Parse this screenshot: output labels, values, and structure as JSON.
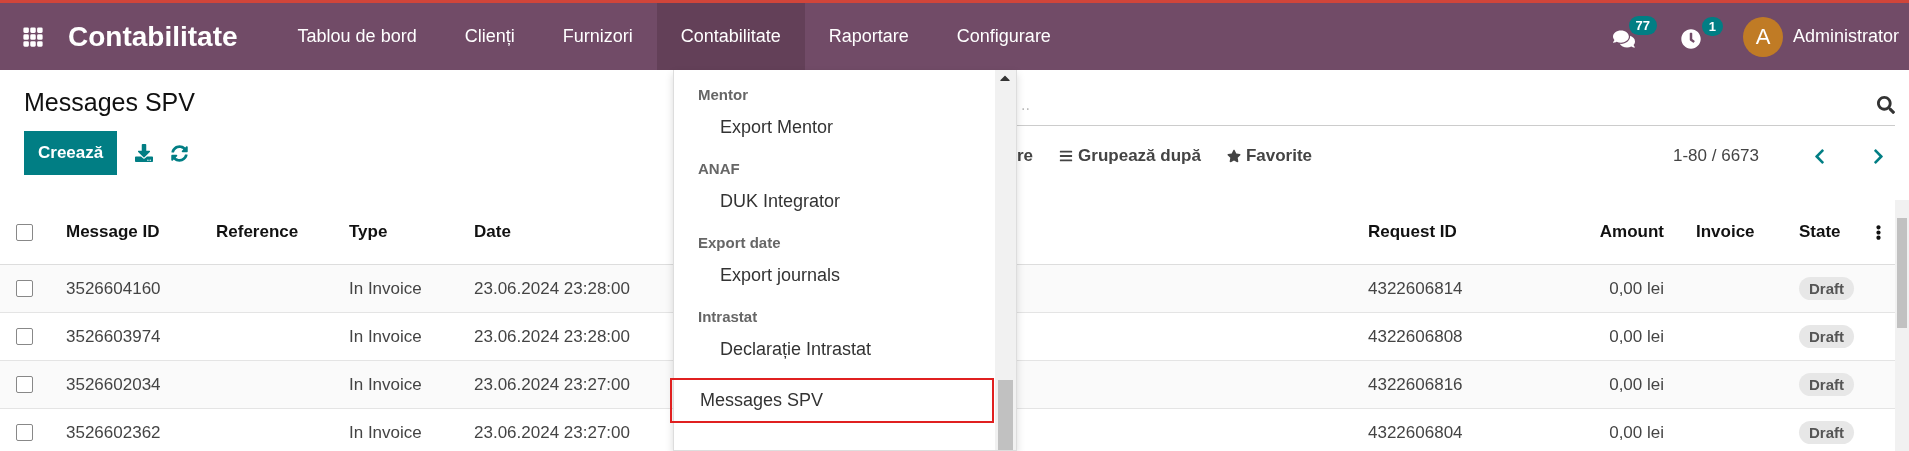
{
  "navbar": {
    "app_name": "Contabilitate",
    "menu": [
      {
        "label": "Tablou de bord",
        "selected": false
      },
      {
        "label": "Clienți",
        "selected": false
      },
      {
        "label": "Furnizori",
        "selected": false
      },
      {
        "label": "Contabilitate",
        "selected": true
      },
      {
        "label": "Raportare",
        "selected": false
      },
      {
        "label": "Configurare",
        "selected": false
      }
    ],
    "messages_badge": "77",
    "activities_badge": "1",
    "user": {
      "initial": "A",
      "name": "Administrator"
    }
  },
  "page": {
    "title": "Messages SPV",
    "create_button": "Creează"
  },
  "search": {
    "placeholder": ".."
  },
  "filters": [
    {
      "kind": "partial",
      "label": "re"
    },
    {
      "kind": "group",
      "label": "Grupează după"
    },
    {
      "kind": "favorite",
      "label": "Favorite"
    }
  ],
  "pager": "1-80 / 6673",
  "table": {
    "select_all_checked": false,
    "columns": [
      "Message ID",
      "Reference",
      "Type",
      "Date",
      "Request ID",
      "Amount",
      "Invoice",
      "State"
    ],
    "rows": [
      {
        "checked": false,
        "message_id": "3526604160",
        "type": "In Invoice",
        "date": "23.06.2024 23:28:00",
        "request_id": "4322606814",
        "amount": "0,00 lei",
        "state": "Draft"
      },
      {
        "checked": false,
        "message_id": "3526603974",
        "type": "In Invoice",
        "date": "23.06.2024 23:28:00",
        "request_id": "4322606808",
        "amount": "0,00 lei",
        "state": "Draft"
      },
      {
        "checked": false,
        "message_id": "3526602034",
        "type": "In Invoice",
        "date": "23.06.2024 23:27:00",
        "request_id": "4322606816",
        "amount": "0,00 lei",
        "state": "Draft"
      },
      {
        "checked": false,
        "message_id": "3526602362",
        "type": "In Invoice",
        "date": "23.06.2024 23:27:00",
        "request_id": "4322606804",
        "amount": "0,00 lei",
        "state": "Draft"
      }
    ]
  },
  "dropdown": {
    "sections": [
      {
        "heading": "Mentor",
        "items": [
          {
            "label": "Export Mentor",
            "highlighted": false
          }
        ]
      },
      {
        "heading": "ANAF",
        "items": [
          {
            "label": "DUK Integrator",
            "highlighted": false
          }
        ]
      },
      {
        "heading": "Export date",
        "items": [
          {
            "label": "Export journals",
            "highlighted": false
          }
        ]
      },
      {
        "heading": "Intrastat",
        "items": [
          {
            "label": "Declarație Intrastat",
            "highlighted": false
          }
        ]
      },
      {
        "items": [
          {
            "label": "Messages SPV",
            "highlighted": true
          }
        ]
      }
    ]
  }
}
